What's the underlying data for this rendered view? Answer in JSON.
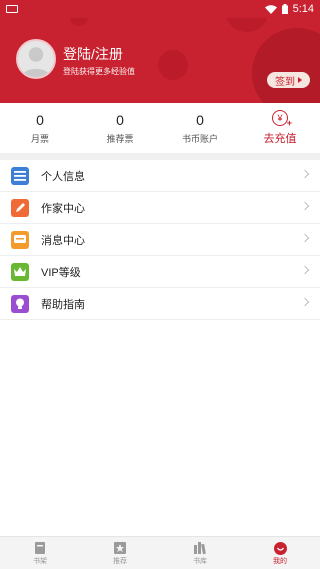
{
  "status_bar": {
    "time": "5:14"
  },
  "profile": {
    "login_title": "登陆/注册",
    "login_subtitle": "登陆获得更多经验值",
    "signin_label": "签到"
  },
  "stats": [
    {
      "value": "0",
      "label": "月票"
    },
    {
      "value": "0",
      "label": "推荐票"
    },
    {
      "value": "0",
      "label": "书币账户"
    }
  ],
  "recharge": {
    "icon_text": "¥",
    "label": "去充值"
  },
  "menu": [
    {
      "label": "个人信息",
      "icon": "personal-info-icon",
      "color": "#3d7fd6"
    },
    {
      "label": "作家中心",
      "icon": "pencil-icon",
      "color": "#ef6a35"
    },
    {
      "label": "消息中心",
      "icon": "message-icon",
      "color": "#f39b2d"
    },
    {
      "label": "VIP等级",
      "icon": "crown-icon",
      "color": "#69b833"
    },
    {
      "label": "帮助指南",
      "icon": "lightbulb-icon",
      "color": "#9b4fd0"
    }
  ],
  "tabs": [
    {
      "label": "书架",
      "icon": "bookshelf-icon",
      "active": false
    },
    {
      "label": "推荐",
      "icon": "recommend-icon",
      "active": false
    },
    {
      "label": "书库",
      "icon": "library-icon",
      "active": false
    },
    {
      "label": "我的",
      "icon": "profile-icon",
      "active": true
    }
  ],
  "colors": {
    "brand": "#c8212f",
    "tab_active": "#c8212f",
    "tab_inactive": "#999999"
  }
}
